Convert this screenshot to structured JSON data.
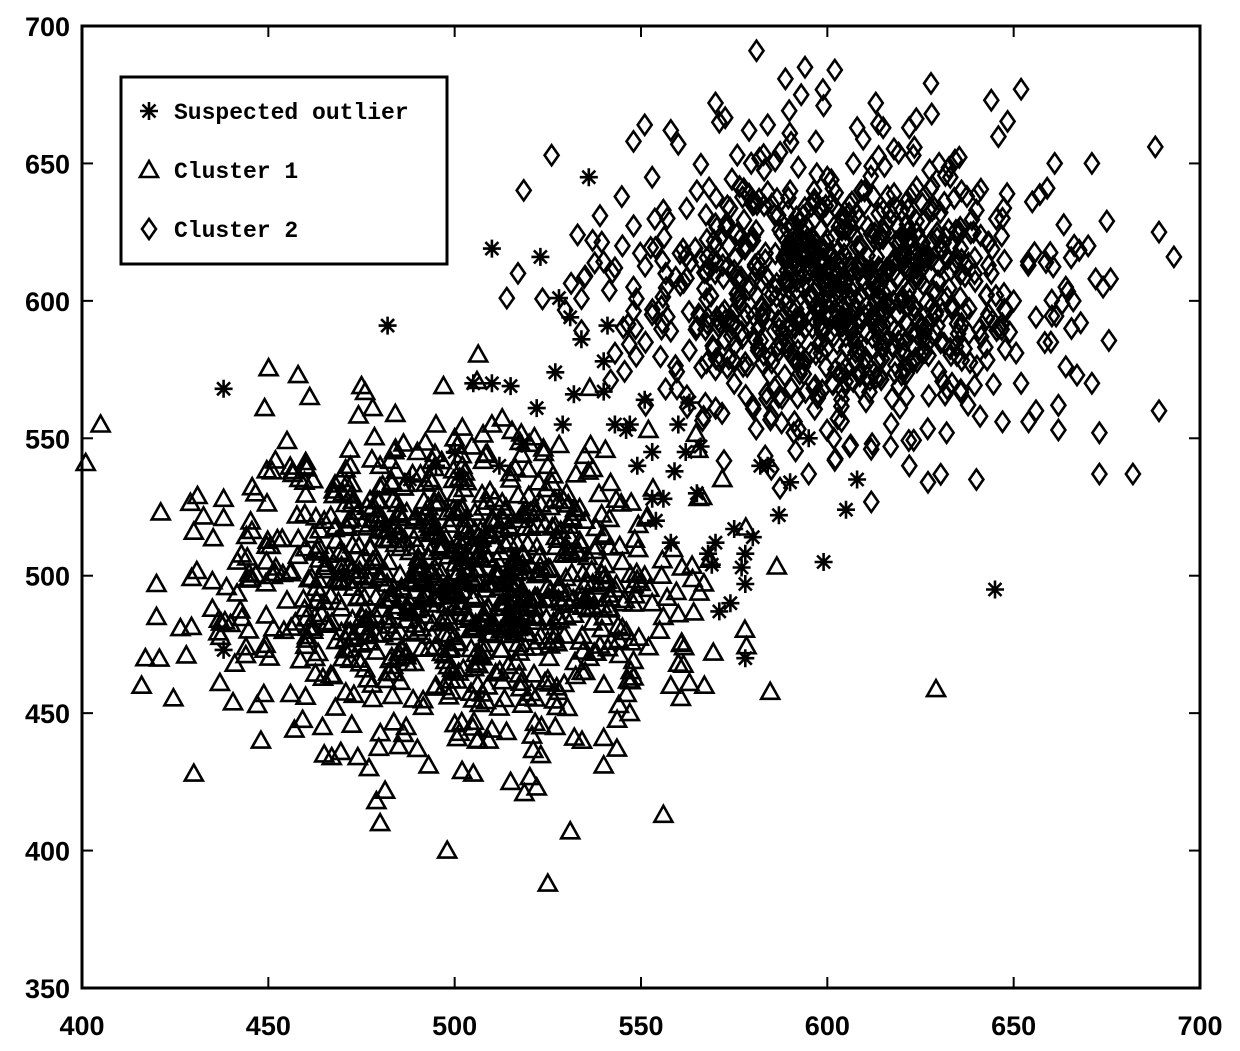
{
  "chart_data": {
    "type": "scatter",
    "title": "",
    "xlabel": "",
    "ylabel": "",
    "xlim": [
      400,
      700
    ],
    "ylim": [
      350,
      700
    ],
    "xticks": [
      400,
      450,
      500,
      550,
      600,
      650,
      700
    ],
    "yticks": [
      350,
      400,
      450,
      500,
      550,
      600,
      650,
      700
    ],
    "grid": false,
    "legend": {
      "position": "top-left",
      "entries": [
        {
          "label": "Suspected outlier",
          "marker": "asterisk"
        },
        {
          "label": "Cluster 1",
          "marker": "triangle"
        },
        {
          "label": "Cluster 2",
          "marker": "diamond"
        }
      ]
    },
    "series": [
      {
        "name": "Cluster 1",
        "marker": "triangle",
        "dense_core": {
          "center": [
            500,
            500
          ],
          "spread": [
            28,
            26
          ],
          "count": 900,
          "seed": 11
        },
        "points": [
          [
            401,
            541
          ],
          [
            405,
            555
          ],
          [
            417,
            470
          ],
          [
            416,
            460
          ],
          [
            420,
            485
          ],
          [
            420,
            497
          ],
          [
            428,
            471
          ],
          [
            430,
            428
          ],
          [
            430,
            516
          ],
          [
            431,
            529
          ],
          [
            435,
            488
          ],
          [
            435,
            498
          ],
          [
            437,
            461
          ],
          [
            438,
            521
          ],
          [
            438,
            528
          ],
          [
            441,
            468
          ],
          [
            444,
            474
          ],
          [
            447,
            453
          ],
          [
            448,
            440
          ],
          [
            449,
            561
          ],
          [
            451,
            538
          ],
          [
            452,
            503
          ],
          [
            455,
            491
          ],
          [
            455,
            549
          ],
          [
            457,
            444
          ],
          [
            458,
            573
          ],
          [
            460,
            456
          ],
          [
            462,
            480
          ],
          [
            465,
            435
          ],
          [
            467,
            434
          ],
          [
            468,
            452
          ],
          [
            470,
            470
          ],
          [
            472,
            540
          ],
          [
            474,
            434
          ],
          [
            475,
            569
          ],
          [
            477,
            430
          ],
          [
            478,
            561
          ],
          [
            479,
            418
          ],
          [
            480,
            410
          ],
          [
            485,
            438
          ],
          [
            487,
            445
          ],
          [
            490,
            437
          ],
          [
            493,
            431
          ],
          [
            495,
            555
          ],
          [
            497,
            569
          ],
          [
            498,
            400
          ],
          [
            500,
            446
          ],
          [
            502,
            429
          ],
          [
            505,
            428
          ],
          [
            506,
            440
          ],
          [
            510,
            444
          ],
          [
            512,
            452
          ],
          [
            515,
            425
          ],
          [
            522,
            423
          ],
          [
            525,
            388
          ],
          [
            527,
            445
          ],
          [
            531,
            407
          ],
          [
            535,
            465
          ],
          [
            538,
            472
          ],
          [
            540,
            441
          ],
          [
            540,
            431
          ],
          [
            545,
            481
          ],
          [
            547,
            450
          ],
          [
            548,
            469
          ],
          [
            552,
            474
          ],
          [
            555,
            480
          ],
          [
            556,
            413
          ],
          [
            558,
            460
          ],
          [
            560,
            468
          ],
          [
            563,
            461
          ],
          [
            567,
            460
          ],
          [
            556,
            485
          ],
          [
            551,
            500
          ],
          [
            557,
            492
          ],
          [
            561,
            503
          ],
          [
            560,
            486
          ],
          [
            545,
            505
          ],
          [
            540,
            515
          ],
          [
            535,
            520
          ],
          [
            530,
            530
          ],
          [
            548,
            463
          ],
          [
            553,
            490
          ],
          [
            543,
            495
          ],
          [
            537,
            483
          ],
          [
            465,
            520
          ],
          [
            460,
            510
          ],
          [
            470,
            530
          ],
          [
            480,
            540
          ],
          [
            490,
            545
          ],
          [
            500,
            550
          ],
          [
            510,
            555
          ],
          [
            520,
            548
          ],
          [
            525,
            540
          ],
          [
            515,
            535
          ],
          [
            530,
            510
          ],
          [
            528,
            495
          ],
          [
            485,
            470
          ],
          [
            475,
            475
          ],
          [
            495,
            460
          ],
          [
            505,
            455
          ]
        ]
      },
      {
        "name": "Cluster 2",
        "marker": "diamond",
        "dense_core": {
          "center": [
            600,
            603
          ],
          "spread": [
            26,
            24
          ],
          "count": 850,
          "seed": 23
        },
        "points": [
          [
            514,
            601
          ],
          [
            517,
            610
          ],
          [
            526,
            653
          ],
          [
            533,
            624
          ],
          [
            535,
            609
          ],
          [
            537,
            622
          ],
          [
            539,
            631
          ],
          [
            545,
            620
          ],
          [
            548,
            658
          ],
          [
            551,
            664
          ],
          [
            553,
            645
          ],
          [
            556,
            633
          ],
          [
            558,
            662
          ],
          [
            560,
            657
          ],
          [
            565,
            640
          ],
          [
            570,
            672
          ],
          [
            571,
            665
          ],
          [
            575,
            611
          ],
          [
            579,
            662
          ],
          [
            581,
            691
          ],
          [
            584,
            664
          ],
          [
            586,
            651
          ],
          [
            593,
            675
          ],
          [
            594,
            685
          ],
          [
            599,
            671
          ],
          [
            602,
            684
          ],
          [
            607,
            650
          ],
          [
            613,
            672
          ],
          [
            615,
            663
          ],
          [
            622,
            663
          ],
          [
            628,
            668
          ],
          [
            630,
            650
          ],
          [
            633,
            645
          ],
          [
            636,
            640
          ],
          [
            640,
            633
          ],
          [
            644,
            673
          ],
          [
            647,
            630
          ],
          [
            652,
            677
          ],
          [
            655,
            636
          ],
          [
            659,
            641
          ],
          [
            661,
            650
          ],
          [
            664,
            605
          ],
          [
            666,
            600
          ],
          [
            668,
            592
          ],
          [
            670,
            620
          ],
          [
            671,
            650
          ],
          [
            672,
            608
          ],
          [
            674,
            605
          ],
          [
            675,
            629
          ],
          [
            676,
            608
          ],
          [
            689,
            625
          ],
          [
            693,
            616
          ],
          [
            688,
            656
          ],
          [
            689,
            560
          ],
          [
            682,
            537
          ],
          [
            673,
            537
          ],
          [
            673,
            552
          ],
          [
            671,
            570
          ],
          [
            667,
            573
          ],
          [
            664,
            576
          ],
          [
            662,
            562
          ],
          [
            662,
            553
          ],
          [
            656,
            560
          ],
          [
            654,
            556
          ],
          [
            652,
            570
          ],
          [
            647,
            556
          ],
          [
            641,
            558
          ],
          [
            640,
            535
          ],
          [
            632,
            552
          ],
          [
            627,
            534
          ],
          [
            622,
            540
          ],
          [
            617,
            547
          ],
          [
            612,
            548
          ],
          [
            606,
            547
          ],
          [
            602,
            542
          ],
          [
            595,
            537
          ],
          [
            591,
            552
          ],
          [
            585,
            558
          ],
          [
            580,
            562
          ],
          [
            575,
            570
          ],
          [
            570,
            575
          ],
          [
            563,
            582
          ],
          [
            558,
            589
          ],
          [
            553,
            595
          ],
          [
            548,
            605
          ],
          [
            543,
            612
          ],
          [
            620,
            633
          ],
          [
            628,
            622
          ],
          [
            636,
            615
          ],
          [
            644,
            610
          ],
          [
            650,
            600
          ],
          [
            656,
            594
          ],
          [
            660,
            585
          ],
          [
            646,
            590
          ],
          [
            638,
            588
          ],
          [
            610,
            640
          ],
          [
            600,
            645
          ],
          [
            590,
            640
          ],
          [
            580,
            635
          ],
          [
            570,
            628
          ]
        ]
      },
      {
        "name": "Suspected outlier",
        "marker": "asterisk",
        "points": [
          [
            438,
            568
          ],
          [
            438,
            473
          ],
          [
            482,
            591
          ],
          [
            510,
            619
          ],
          [
            523,
            616
          ],
          [
            528,
            601
          ],
          [
            531,
            594
          ],
          [
            534,
            586
          ],
          [
            536,
            645
          ],
          [
            540,
            567
          ],
          [
            540,
            578
          ],
          [
            541,
            591
          ],
          [
            543,
            555
          ],
          [
            546,
            553
          ],
          [
            549,
            540
          ],
          [
            553,
            545
          ],
          [
            553,
            528
          ],
          [
            556,
            528
          ],
          [
            554,
            520
          ],
          [
            558,
            512
          ],
          [
            559,
            538
          ],
          [
            562,
            545
          ],
          [
            565,
            530
          ],
          [
            566,
            547
          ],
          [
            568,
            508
          ],
          [
            569,
            504
          ],
          [
            570,
            512
          ],
          [
            571,
            487
          ],
          [
            574,
            490
          ],
          [
            575,
            517
          ],
          [
            577,
            503
          ],
          [
            578,
            497
          ],
          [
            578,
            470
          ],
          [
            578,
            508
          ],
          [
            580,
            514
          ],
          [
            582,
            540
          ],
          [
            584,
            540
          ],
          [
            587,
            522
          ],
          [
            590,
            534
          ],
          [
            595,
            550
          ],
          [
            599,
            505
          ],
          [
            605,
            524
          ],
          [
            608,
            535
          ],
          [
            645,
            495
          ],
          [
            505,
            570
          ],
          [
            510,
            570
          ],
          [
            515,
            569
          ],
          [
            495,
            540
          ],
          [
            500,
            545
          ],
          [
            488,
            535
          ],
          [
            527,
            574
          ],
          [
            532,
            566
          ],
          [
            529,
            555
          ],
          [
            522,
            561
          ],
          [
            518,
            548
          ],
          [
            512,
            540
          ],
          [
            547,
            555
          ],
          [
            551,
            564
          ],
          [
            560,
            555
          ],
          [
            563,
            563
          ]
        ]
      }
    ]
  }
}
